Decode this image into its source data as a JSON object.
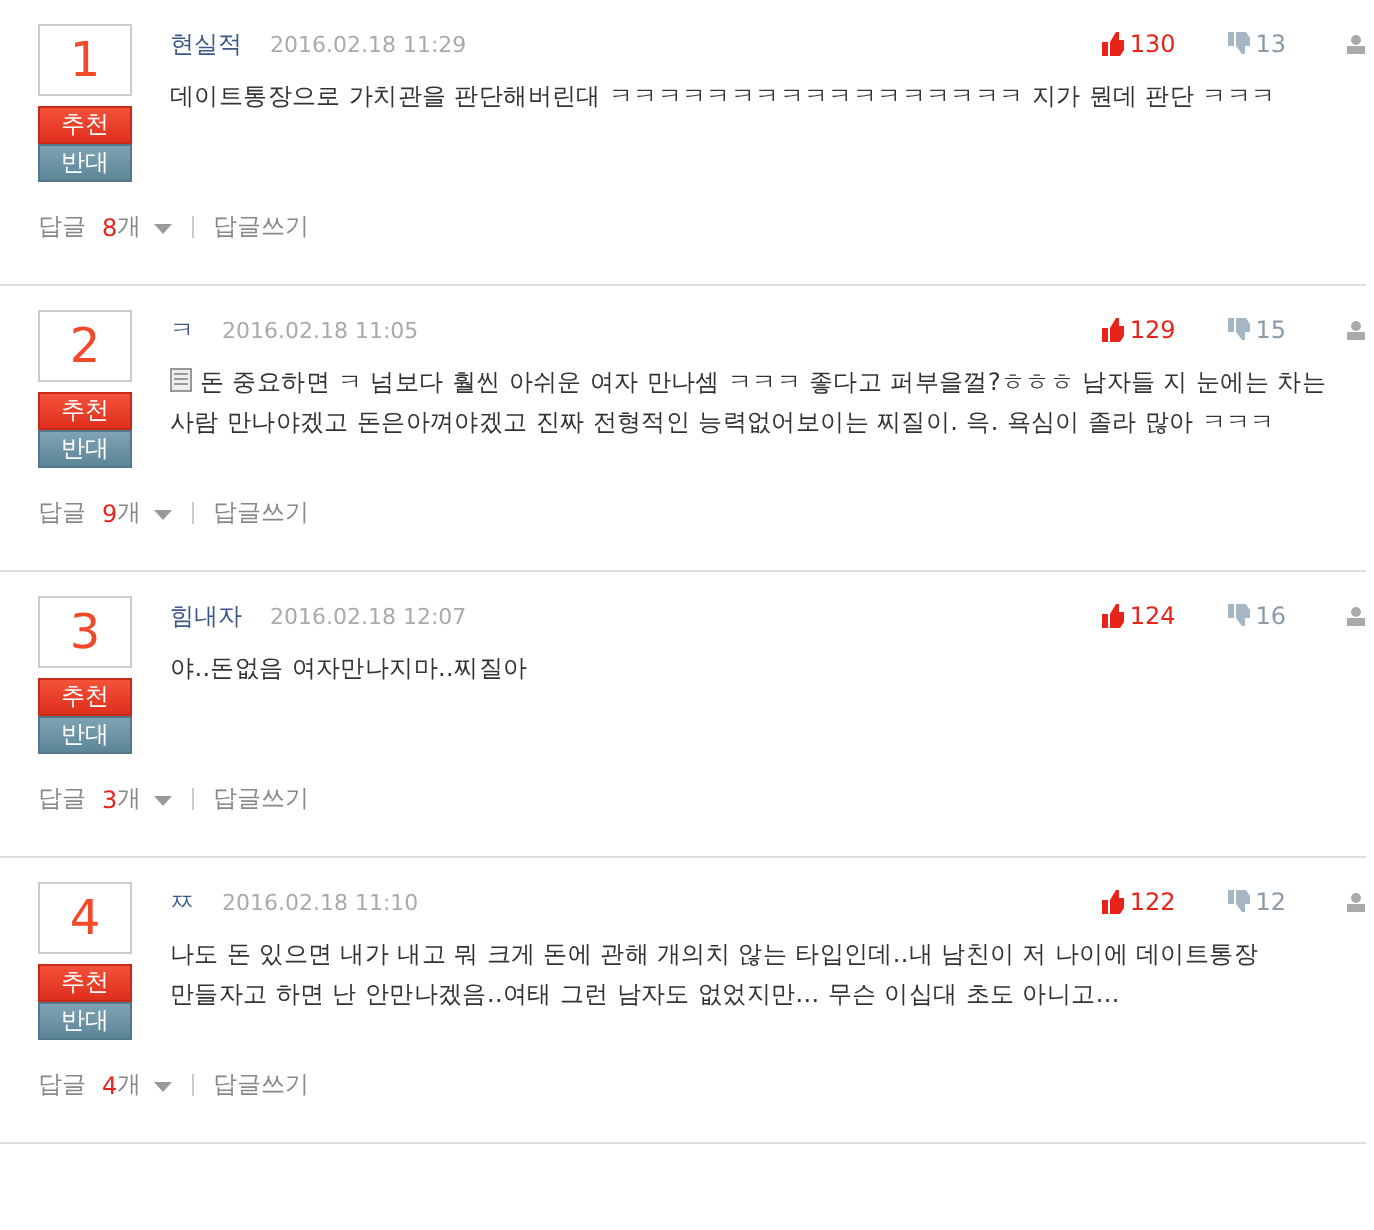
{
  "comments": [
    {
      "rank": "1",
      "vote_up_label": "추천",
      "vote_down_label": "반대",
      "author": "현실적",
      "date": "2016.02.18 11:29",
      "likes": "130",
      "dislikes": "13",
      "memo": false,
      "text": "데이트통장으로 가치관을 판단해버린대 ㅋㅋㅋㅋㅋㅋㅋㅋㅋㅋㅋㅋㅋㅋㅋㅋㅋ 지가 뭔데 판단 ㅋㅋㅋ",
      "reply_label": "답글",
      "reply_count": "8",
      "reply_unit": "개",
      "write_reply": "답글쓰기"
    },
    {
      "rank": "2",
      "vote_up_label": "추천",
      "vote_down_label": "반대",
      "author": "ㅋ",
      "date": "2016.02.18 11:05",
      "likes": "129",
      "dislikes": "15",
      "memo": true,
      "text": "돈 중요하면 ㅋ 넘보다 훨씬 아쉬운 여자 만나셈 ㅋㅋㅋ 좋다고 퍼부을껄?ㅎㅎㅎ 남자들 지 눈에는 차는 사람 만나야겠고 돈은아껴야겠고 진짜 전형적인 능력없어보이는 찌질이. 윽. 욕심이 졸라 많아 ㅋㅋㅋ",
      "reply_label": "답글",
      "reply_count": "9",
      "reply_unit": "개",
      "write_reply": "답글쓰기"
    },
    {
      "rank": "3",
      "vote_up_label": "추천",
      "vote_down_label": "반대",
      "author": "힘내자",
      "date": "2016.02.18 12:07",
      "likes": "124",
      "dislikes": "16",
      "memo": false,
      "text": "야..돈없음 여자만나지마..찌질아",
      "reply_label": "답글",
      "reply_count": "3",
      "reply_unit": "개",
      "write_reply": "답글쓰기"
    },
    {
      "rank": "4",
      "vote_up_label": "추천",
      "vote_down_label": "반대",
      "author": "ㅉ",
      "date": "2016.02.18 11:10",
      "likes": "122",
      "dislikes": "12",
      "memo": false,
      "text": "나도 돈 있으면 내가 내고 뭐 크게 돈에 관해 개의치 않는 타입인데..내 남친이 저 나이에 데이트통장 만들자고 하면 난 안만나겠음..여태 그런 남자도 없었지만... 무슨 이십대 초도 아니고...",
      "reply_label": "답글",
      "reply_count": "4",
      "reply_unit": "개",
      "write_reply": "답글쓰기"
    }
  ]
}
